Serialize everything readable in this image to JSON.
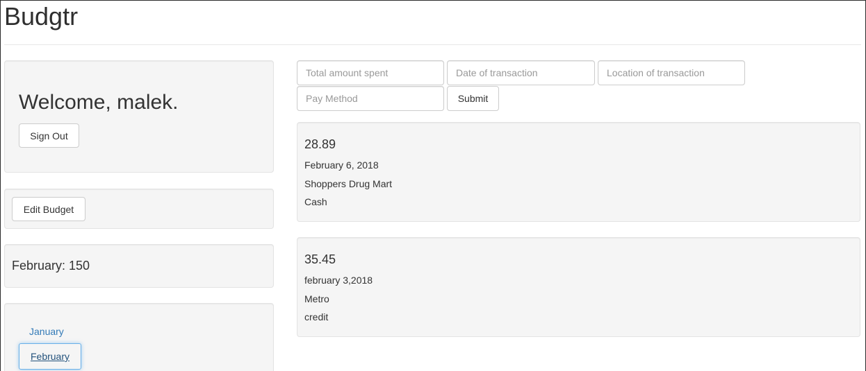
{
  "app": {
    "title": "Budgtr"
  },
  "user_panel": {
    "welcome": "Welcome, malek.",
    "sign_out_label": "Sign Out"
  },
  "budget_panel": {
    "edit_label": "Edit Budget",
    "summary": "February: 150"
  },
  "months": {
    "items": [
      {
        "label": "January",
        "active": false
      },
      {
        "label": "February",
        "active": true
      }
    ]
  },
  "form": {
    "amount_placeholder": "Total amount spent",
    "date_placeholder": "Date of transaction",
    "location_placeholder": "Location of transaction",
    "method_placeholder": "Pay Method",
    "submit_label": "Submit"
  },
  "transactions": [
    {
      "amount": "28.89",
      "date": "February 6, 2018",
      "location": "Shoppers Drug Mart",
      "method": "Cash"
    },
    {
      "amount": "35.45",
      "date": "february 3,2018",
      "location": "Metro",
      "method": "credit"
    }
  ]
}
